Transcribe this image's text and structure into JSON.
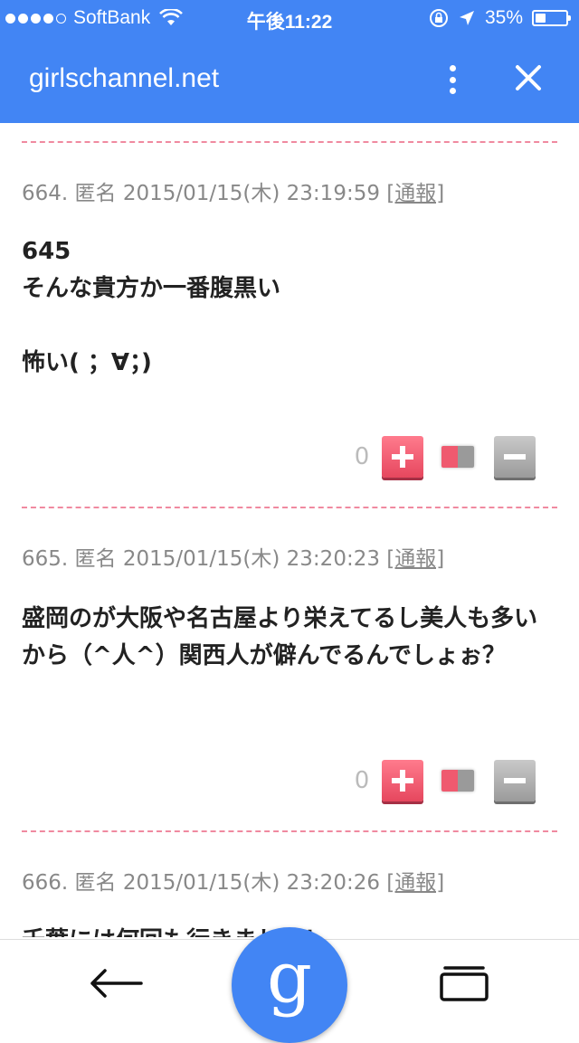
{
  "status_bar": {
    "carrier": "SoftBank",
    "time": "午後11:22",
    "battery": "35%",
    "battery_level": 0.35
  },
  "header": {
    "domain": "girlschannel.net"
  },
  "comments": [
    {
      "number": "664.",
      "author": "匿名",
      "timestamp": "2015/01/15(木) 23:19:59",
      "report": "[通報]",
      "text": "645\nそんな貴方か一番腹黒い\n\n怖い( ；∀；)",
      "votes": "0"
    },
    {
      "number": "665.",
      "author": "匿名",
      "timestamp": "2015/01/15(木) 23:20:23",
      "report": "[通報]",
      "text": "盛岡のが大阪や名古屋より栄えてるし美人も多いから（^人^）関西人が僻んでるんでしょぉ？",
      "votes": "0"
    },
    {
      "number": "666.",
      "author": "匿名",
      "timestamp": "2015/01/15(木) 23:20:26",
      "report": "[通報]",
      "text": "千葉には何回も行きました！"
    }
  ],
  "bottom_bar": {
    "google_label": "g"
  },
  "icons": {
    "back": "back-arrow-icon",
    "google": "google-icon",
    "tabs": "tabs-icon",
    "menu": "more-vert-icon",
    "close": "close-icon"
  },
  "colors": {
    "brand_blue": "#4285f4",
    "divider_pink": "#f08aa0",
    "plus_red": "#e6475e",
    "minus_gray": "#9b9b9b"
  }
}
